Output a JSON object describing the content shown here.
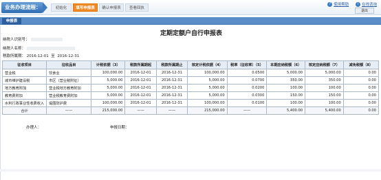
{
  "header": {
    "flow_title": "业务办理流程：",
    "steps": [
      {
        "label": "初始化",
        "active": false
      },
      {
        "label": "填写申报表",
        "active": true
      },
      {
        "label": "确认申报表",
        "active": false
      },
      {
        "label": "查看回执",
        "active": false
      }
    ],
    "links": [
      "使用帮助",
      "在线咨询"
    ],
    "exit_label": "退出"
  },
  "tab": {
    "label": "申报表"
  },
  "form": {
    "title": "定期定额户自行申报表",
    "taxpayer_id_label": "纳税人识别号：",
    "taxpayer_name_label": "纳税人名称：",
    "period_label": "税款所属期：",
    "period_start": "2016-12-01",
    "period_sep": "至",
    "period_end": "2016-12-31"
  },
  "table": {
    "columns": [
      "征收项目",
      "征收品目",
      "计税依据（3）",
      "税款所属期起",
      "税款所属期止",
      "核定计税依据（4）",
      "税率（征收率）（5）",
      "本期应纳税额（6）",
      "核定应纳税额（7）",
      "减免税额（8）"
    ],
    "rows": [
      [
        "营业税",
        "饮食业",
        "100,000.00",
        "2016-12-01",
        "2016-12-31",
        "100,000.00",
        "0.0500",
        "5,000.00",
        "5,000.00",
        "0.00"
      ],
      [
        "城市维护建设税",
        "市区（营业税附征）",
        "5,000.00",
        "2016-12-01",
        "2016-12-31",
        "5,000.00",
        "0.0700",
        "350.00",
        "350.00",
        "0.00"
      ],
      [
        "地方教育附加",
        "营业税地方教育附加",
        "5,000.00",
        "2016-12-01",
        "2016-12-31",
        "5,000.00",
        "0.0200",
        "100.00",
        "100.00",
        "0.00"
      ],
      [
        "教育费附加",
        "营业税教育费附加",
        "5,000.00",
        "2016-12-01",
        "2016-12-31",
        "5,000.00",
        "0.0300",
        "150.00",
        "150.00",
        "0.00"
      ],
      [
        "水利行政事业性收费收入",
        "堤围防护费",
        "100,000.00",
        "2016-12-01",
        "2016-12-31",
        "100,000.00",
        "0.0100",
        "100.00",
        "100.00",
        "0.00"
      ]
    ],
    "total": [
      "合计",
      "——",
      "215,000.00",
      "——",
      "——",
      "215,000.00",
      "——",
      "5,400.00",
      "5,400.00",
      "0.00"
    ]
  },
  "footer": {
    "handler_label": "办理人：",
    "date_label": "申报日期："
  }
}
